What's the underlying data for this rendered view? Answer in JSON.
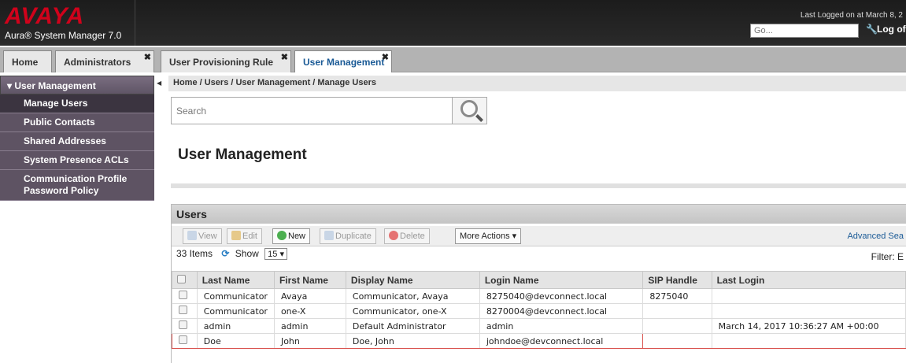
{
  "header": {
    "logo": "AVAYA",
    "product": "Aura® System Manager 7.0",
    "last_logged": "Last Logged on at March 8, 2",
    "go_placeholder": "Go...",
    "logoff": "Log of"
  },
  "tabs": [
    {
      "label": "Home"
    },
    {
      "label": "Administrators"
    },
    {
      "label": "User Provisioning Rule"
    },
    {
      "label": "User Management"
    }
  ],
  "sidebar": {
    "header": "User Management",
    "items": [
      {
        "label": "Manage Users"
      },
      {
        "label": "Public Contacts"
      },
      {
        "label": "Shared Addresses"
      },
      {
        "label": "System Presence ACLs"
      },
      {
        "label": "Communication Profile Password Policy"
      }
    ]
  },
  "breadcrumb": "Home / Users / User Management / Manage Users",
  "search": {
    "placeholder": "Search"
  },
  "page_title": "User Management",
  "users_panel": {
    "title": "Users",
    "toolbar": {
      "view": "View",
      "edit": "Edit",
      "new": "New",
      "duplicate": "Duplicate",
      "delete": "Delete",
      "more_actions": "More Actions ▾",
      "advanced": "Advanced Sea"
    },
    "count": "33 Items",
    "show_label": "Show",
    "show_value": "15 ▾",
    "filter": "Filter: E",
    "columns": [
      "Last Name",
      "First Name",
      "Display Name",
      "Login Name",
      "SIP Handle",
      "Last Login"
    ],
    "rows": [
      [
        "Communicator",
        "Avaya",
        "Communicator, Avaya",
        "8275040@devconnect.local",
        "8275040",
        ""
      ],
      [
        "Communicator",
        "one-X",
        "Communicator, one-X",
        "8270004@devconnect.local",
        "",
        ""
      ],
      [
        "admin",
        "admin",
        "Default Administrator",
        "admin",
        "",
        "March 14, 2017 10:36:27 AM +00:00"
      ],
      [
        "Doe",
        "John",
        "Doe, John",
        "johndoe@devconnect.local",
        "",
        ""
      ]
    ]
  },
  "colors": {
    "accent": "#1a5a96",
    "sidebar_bg": "#5e5363",
    "logo_red": "#d0021b",
    "highlight_border": "#d9534f"
  }
}
